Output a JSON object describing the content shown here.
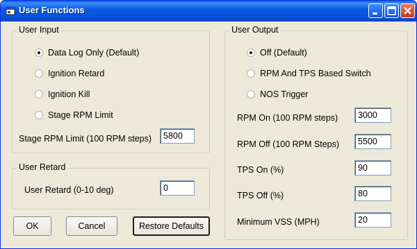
{
  "window": {
    "title": "User Functions",
    "icons": [
      "app-icon",
      "minimize-icon",
      "maximize-icon",
      "close-icon"
    ]
  },
  "user_input": {
    "legend": "User Input",
    "options": [
      {
        "label": "Data Log Only (Default)",
        "checked": true
      },
      {
        "label": "Ignition Retard",
        "checked": false
      },
      {
        "label": "Ignition Kill",
        "checked": false
      },
      {
        "label": "Stage RPM Limit",
        "checked": false
      }
    ],
    "stage_rpm_label": "Stage RPM Limit (100 RPM steps)",
    "stage_rpm_value": "5800"
  },
  "user_retard": {
    "legend": "User Retard",
    "label": "User Retard (0-10 deg)",
    "value": "0"
  },
  "user_output": {
    "legend": "User Output",
    "options": [
      {
        "label": "Off (Default)",
        "checked": true
      },
      {
        "label": "RPM And TPS Based Switch",
        "checked": false
      },
      {
        "label": "NOS Trigger",
        "checked": false
      }
    ],
    "fields": [
      {
        "label": "RPM On (100 RPM steps)",
        "value": "3000"
      },
      {
        "label": "RPM Off (100 RPM Steps)",
        "value": "5500"
      },
      {
        "label": "TPS On (%)",
        "value": "90"
      },
      {
        "label": "TPS Off (%)",
        "value": "80"
      },
      {
        "label": "Minimum VSS (MPH)",
        "value": "20"
      }
    ]
  },
  "buttons": {
    "ok": "OK",
    "cancel": "Cancel",
    "restore": "Restore Defaults"
  }
}
